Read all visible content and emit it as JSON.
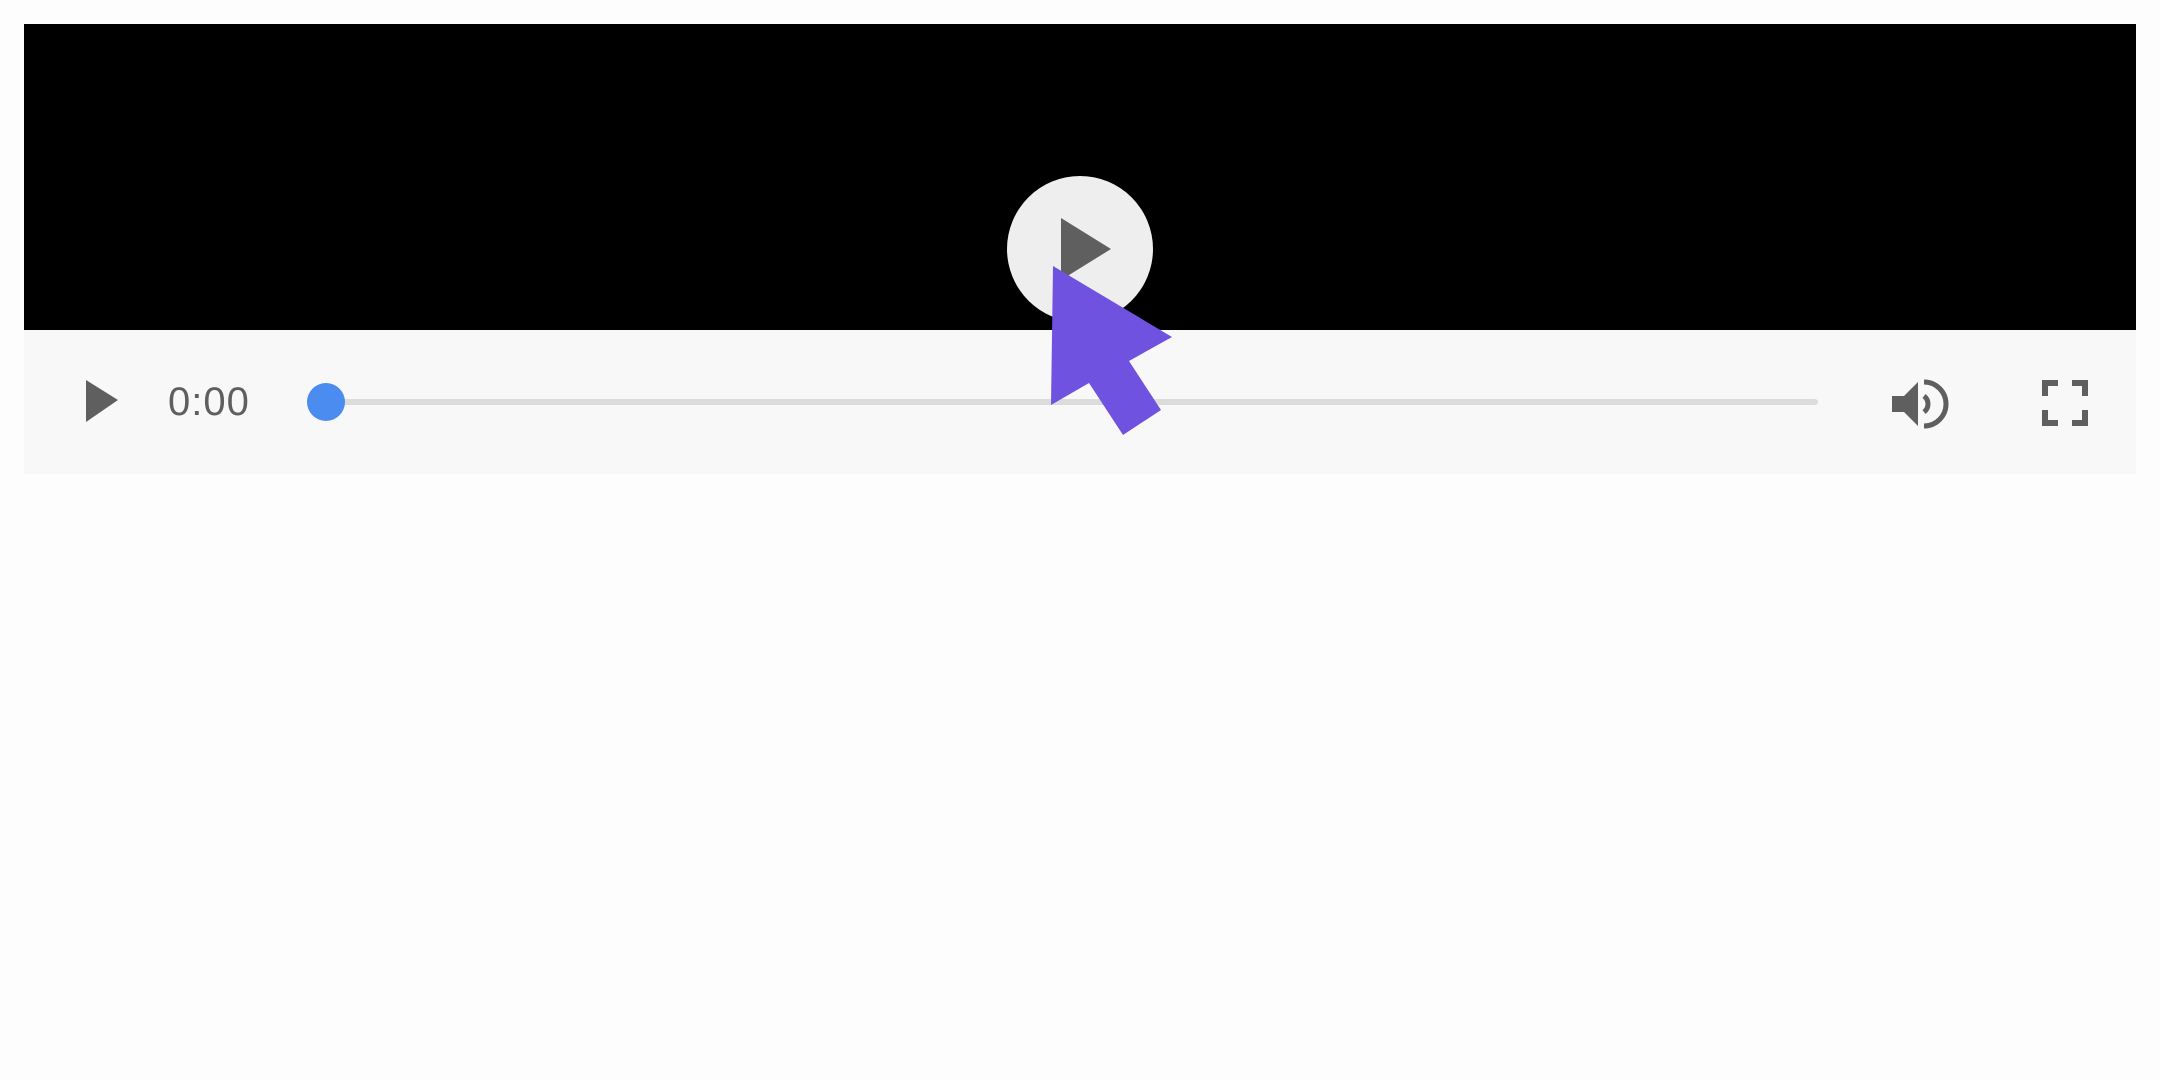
{
  "player": {
    "time_display": "0:00",
    "progress": 0,
    "icons": {
      "big_play": "play-icon",
      "play": "play-icon",
      "volume": "volume-up-icon",
      "fullscreen": "fullscreen-icon",
      "cursor": "mouse-pointer-icon"
    },
    "colors": {
      "video_background": "#000000",
      "controls_background": "#f8f8f8",
      "seek_thumb": "#4a8cf0",
      "icon": "#5f5f5f",
      "cursor": "#6f52e0"
    }
  }
}
